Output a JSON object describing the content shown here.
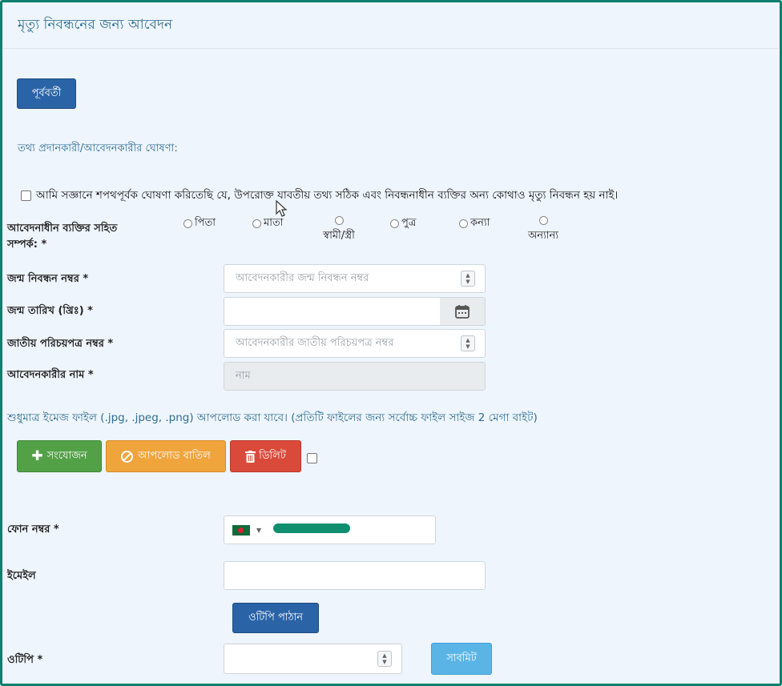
{
  "page": {
    "title": "মৃত্যু নিবন্ধনের জন্য আবেদন",
    "prev_button": "পূর্ববর্তী"
  },
  "declaration": {
    "section_label": "তথ্য প্রদানকারী/আবেদনকারীর ঘোষণা:",
    "text": "আমি সজ্ঞানে শপথপূর্বক ঘোষণা করিতেছি যে, উপরোক্ত যাবতীয় তথ্য সঠিক এবং নিবন্ধনাধীন ব্যক্তির অন্য কোথাও মৃত্যু নিবন্ধন হয় নাই।"
  },
  "relation": {
    "label_line1": "আবেদনাধীন ব্যক্তির সহিত",
    "label_line2": "সম্পর্ক: *",
    "options": [
      "পিতা",
      "মাতা",
      "স্বামী/স্ত্রী",
      "পুত্র",
      "কন্যা",
      "অন্যান্য"
    ]
  },
  "fields": {
    "birth_reg_label": "জন্ম নিবন্ধন নম্বর *",
    "birth_reg_placeholder": "আবেদনকারীর জন্ম নিবন্ধন  নম্বর",
    "dob_label": "জন্ম তারিখ (খ্রিঃ) *",
    "nid_label": "জাতীয় পরিচয়পত্র নম্বর *",
    "nid_placeholder": "আবেদনকারীর জাতীয় পরিচয়পত্র নম্বর",
    "name_label": "আবেদনকারীর নাম *",
    "name_placeholder": "নাম"
  },
  "upload": {
    "note": "শুধুমাত্র ইমেজ ফাইল (.jpg, .jpeg, .png) আপলোড করা যাবে। (প্রতিটি ফাইলের জন্য সর্বোচ্চ ফাইল সাইজ 2 মেগা বাইট)",
    "add_button": "সংযোজন",
    "cancel_button": "আপলোড বাতিল",
    "delete_button": "ডিলিট"
  },
  "contact": {
    "phone_label": "ফোন নম্বর *",
    "email_label": "ইমেইল",
    "send_otp_button": "ওটিপি পাঠান",
    "otp_label": "ওটিপি *",
    "submit_button": "সাবমিট"
  },
  "colors": {
    "accent": "#2a64a6",
    "title": "#2f6d8f",
    "success": "#53a147",
    "warning": "#f0a43c",
    "danger": "#d94a3b",
    "submit": "#5ab5e6",
    "frame": "#0f7f6f"
  }
}
